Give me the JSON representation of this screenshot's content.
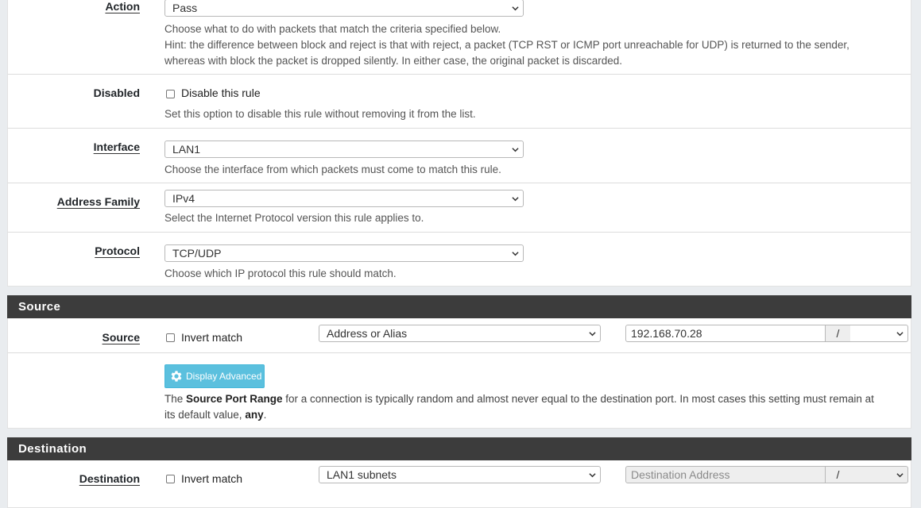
{
  "rule": {
    "action": {
      "label": "Action",
      "value": "Pass",
      "help1": "Choose what to do with packets that match the criteria specified below.",
      "help2": "Hint: the difference between block and reject is that with reject, a packet (TCP RST or ICMP port unreachable for UDP) is returned to the sender,",
      "help3": "whereas with block the packet is dropped silently. In either case, the original packet is discarded."
    },
    "disabled": {
      "label": "Disabled",
      "checkbox_label": "Disable this rule",
      "help": "Set this option to disable this rule without removing it from the list."
    },
    "interface": {
      "label": "Interface",
      "value": "LAN1",
      "help": "Choose the interface from which packets must come to match this rule."
    },
    "address_family": {
      "label": "Address Family",
      "value": "IPv4",
      "help": "Select the Internet Protocol version this rule applies to."
    },
    "protocol": {
      "label": "Protocol",
      "value": "TCP/UDP",
      "help": "Choose which IP protocol this rule should match."
    }
  },
  "source": {
    "section_title": "Source",
    "label": "Source",
    "invert_label": "Invert match",
    "type_value": "Address or Alias",
    "address_value": "192.168.70.28",
    "slash": "/",
    "display_advanced_label": "Display Advanced",
    "help_pre": "The ",
    "help_bold": "Source Port Range",
    "help_mid": " for a connection is typically random and almost never equal to the destination port. In most cases this setting must remain at",
    "help_line2_pre": "its default value, ",
    "help_line2_bold": "any",
    "help_line2_post": "."
  },
  "destination": {
    "section_title": "Destination",
    "label": "Destination",
    "invert_label": "Invert match",
    "type_value": "LAN1 subnets",
    "address_placeholder": "Destination Address",
    "slash": "/"
  },
  "icons": {
    "chevron": "chevron-down-icon",
    "gear": "gear-icon"
  },
  "colors": {
    "section_header_bg": "#3c3c3c",
    "info_button_bg": "#5bc0de"
  }
}
